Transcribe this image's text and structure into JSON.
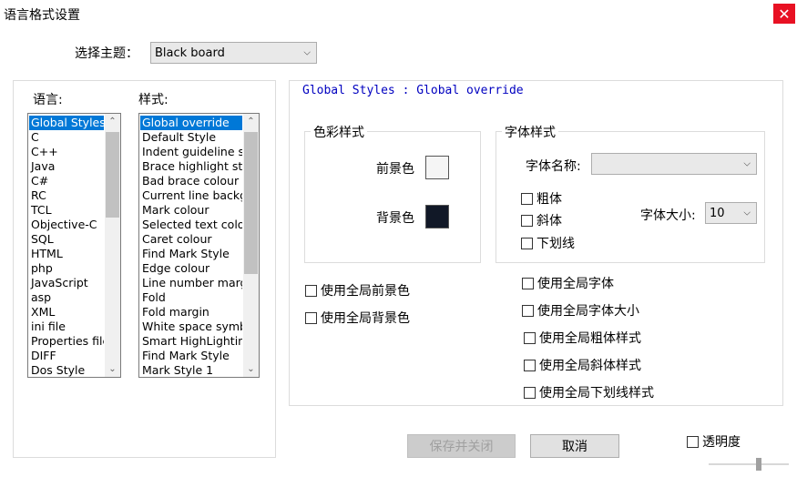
{
  "window": {
    "title": "语言格式设置",
    "close_glyph": "✕"
  },
  "theme": {
    "label": "选择主题：",
    "selected": "Black board"
  },
  "language_panel": {
    "label": "语言:",
    "items": [
      "Global Styles",
      "C",
      "C++",
      "Java",
      "C#",
      "RC",
      "TCL",
      "Objective-C",
      "SQL",
      "HTML",
      "php",
      "JavaScript",
      "asp",
      "XML",
      "ini file",
      "Properties file",
      "DIFF",
      "Dos Style"
    ],
    "selected_index": 0
  },
  "style_panel": {
    "label": "样式:",
    "items": [
      "Global override",
      "Default Style",
      "Indent guideline style",
      "Brace highlight style",
      "Bad brace colour",
      "Current line background colour",
      "Mark colour",
      "Selected text colour",
      "Caret colour",
      "Find Mark Style",
      "Edge colour",
      "Line number margin",
      "Fold",
      "Fold margin",
      "White space symbol",
      "Smart HighLighting",
      "Find Mark Style",
      "Mark Style 1"
    ],
    "selected_index": 0
  },
  "header_text": "Global Styles : Global override",
  "color_group": {
    "title": "色彩样式",
    "fg_label": "前景色",
    "bg_label": "背景色",
    "fg_color": "#f5f5f5",
    "bg_color": "#111827"
  },
  "font_group": {
    "title": "字体样式",
    "font_name_label": "字体名称:",
    "font_name_value": "",
    "bold_label": "粗体",
    "italic_label": "斜体",
    "underline_label": "下划线",
    "size_label": "字体大小:",
    "size_value": "10"
  },
  "global_checks": {
    "use_global_fg": "使用全局前景色",
    "use_global_bg": "使用全局背景色",
    "use_global_font": "使用全局字体",
    "use_global_font_size": "使用全局字体大小",
    "use_global_bold": "使用全局粗体样式",
    "use_global_italic": "使用全局斜体样式",
    "use_global_underline": "使用全局下划线样式"
  },
  "buttons": {
    "save_close": "保存并关闭",
    "cancel": "取消"
  },
  "transparency": {
    "label": "透明度"
  }
}
